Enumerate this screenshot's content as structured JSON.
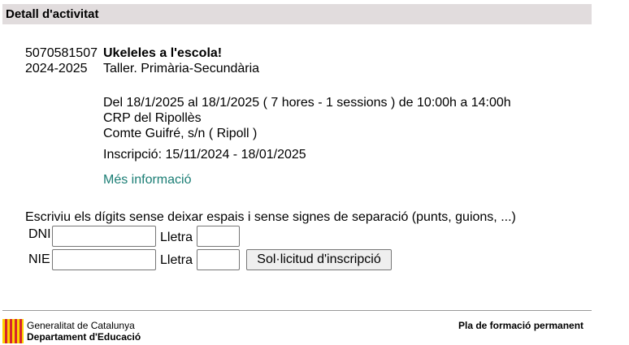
{
  "header": {
    "title": "Detall d'activitat"
  },
  "activity": {
    "code": "5070581507",
    "name": "Ukeleles a l'escola!",
    "year": "2024-2025",
    "type": "Taller. Primària-Secundària",
    "schedule": "Del 18/1/2025 al 18/1/2025 ( 7 hores - 1 sessions ) de 10:00h a 14:00h",
    "center": "CRP del Ripollès",
    "address": "Comte Guifré, s/n ( Ripoll )",
    "registration": "Inscripció: 15/11/2024 - 18/01/2025",
    "more_info": "Més informació"
  },
  "form": {
    "instructions": "Escriviu els dígits sense deixar espais i sense signes de separació (punts, guions, ...)",
    "dni_label": "DNI",
    "nie_label": "NIE",
    "letter_label": "Lletra",
    "dni_value": "",
    "dni_letter_value": "",
    "nie_value": "",
    "nie_letter_value": "",
    "submit_label": "Sol·licitud d'inscripció"
  },
  "footer": {
    "org_line1": "Generalitat de Catalunya",
    "org_line2": "Departament d'Educació",
    "plan": "Pla de formació permanent",
    "logo_icon": "catalan-flag-logo",
    "colors": {
      "logo_red": "#d6252d",
      "logo_yellow": "#fbd300"
    }
  }
}
